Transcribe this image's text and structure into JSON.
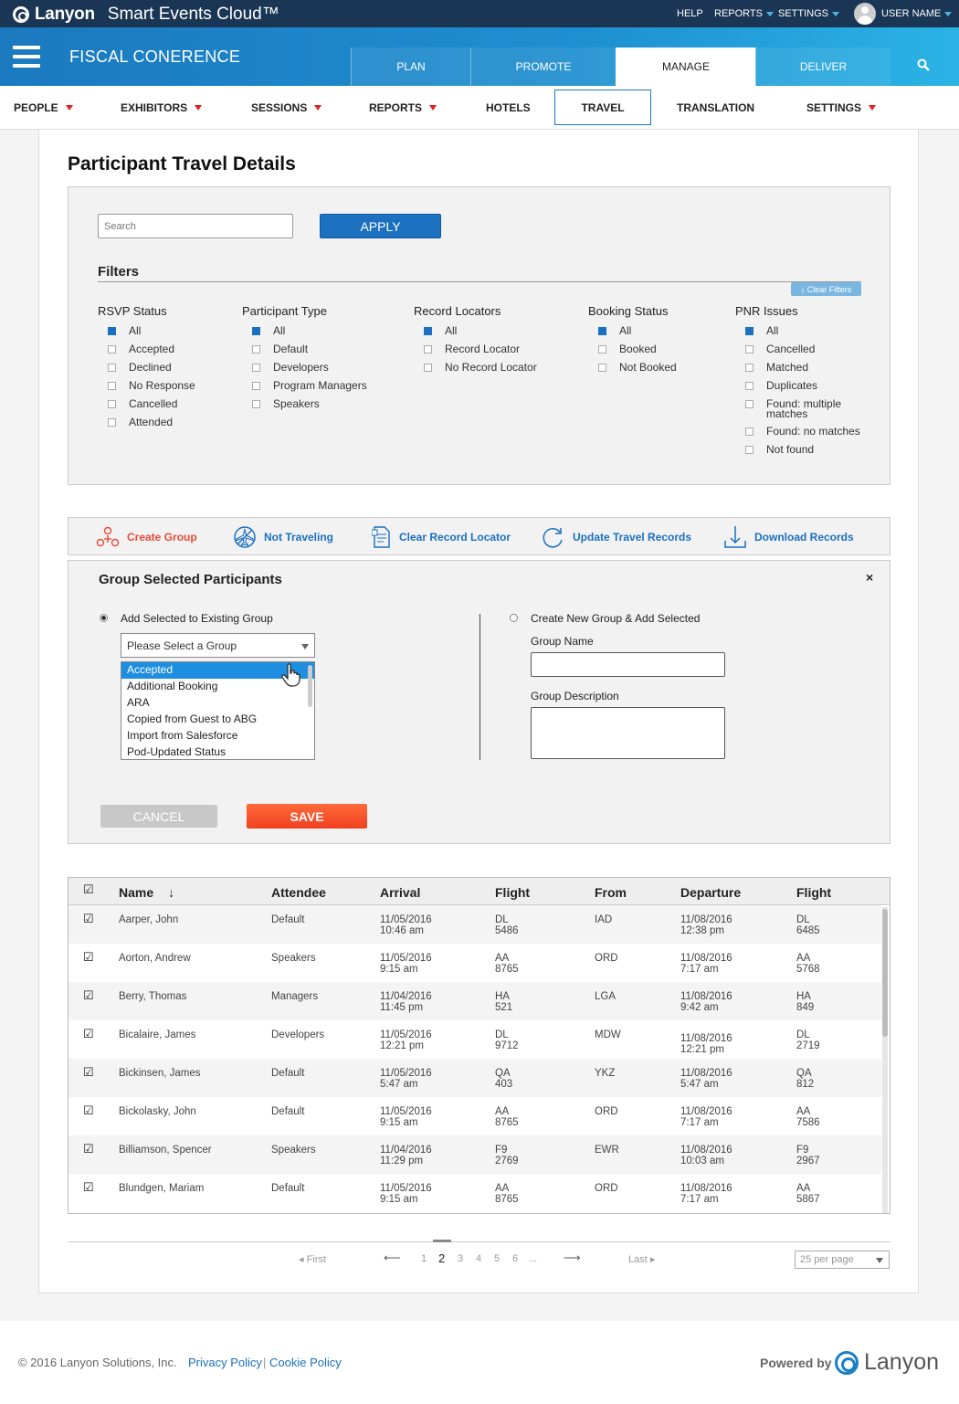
{
  "app": {
    "brand": "Lanyon",
    "product": "Smart Events Cloud™",
    "top_links": [
      "HELP",
      "REPORTS",
      "SETTINGS"
    ],
    "user": "USER NAME"
  },
  "event": {
    "name": "FISCAL CONERENCE",
    "tabs": [
      "PLAN",
      "PROMOTE",
      "MANAGE",
      "DELIVER"
    ],
    "active_tab": "MANAGE"
  },
  "subnav": {
    "items": [
      "PEOPLE",
      "EXHIBITORS",
      "SESSIONS",
      "REPORTS",
      "HOTELS",
      "TRAVEL",
      "TRANSLATION",
      "SETTINGS"
    ],
    "active": "TRAVEL"
  },
  "page": {
    "title": "Participant Travel Details"
  },
  "search": {
    "placeholder": "Search",
    "apply": "APPLY"
  },
  "filters": {
    "title": "Filters",
    "clear": "↓ Clear Filters",
    "groups": [
      {
        "title": "RSVP Status",
        "items": [
          {
            "label": "All",
            "checked": true
          },
          {
            "label": "Accepted",
            "checked": false
          },
          {
            "label": "Declined",
            "checked": false
          },
          {
            "label": "No Response",
            "checked": false
          },
          {
            "label": "Cancelled",
            "checked": false
          },
          {
            "label": "Attended",
            "checked": false
          }
        ]
      },
      {
        "title": "Participant Type",
        "items": [
          {
            "label": "All",
            "checked": true
          },
          {
            "label": "Default",
            "checked": false
          },
          {
            "label": "Developers",
            "checked": false
          },
          {
            "label": "Program Managers",
            "checked": false
          },
          {
            "label": "Speakers",
            "checked": false
          }
        ]
      },
      {
        "title": "Record Locators",
        "items": [
          {
            "label": "All",
            "checked": true
          },
          {
            "label": "Record Locator",
            "checked": false
          },
          {
            "label": "No Record Locator",
            "checked": false
          }
        ]
      },
      {
        "title": "Booking Status",
        "items": [
          {
            "label": "All",
            "checked": true
          },
          {
            "label": "Booked",
            "checked": false
          },
          {
            "label": "Not Booked",
            "checked": false
          }
        ]
      },
      {
        "title": "PNR Issues",
        "items": [
          {
            "label": "All",
            "checked": true
          },
          {
            "label": "Cancelled",
            "checked": false
          },
          {
            "label": "Matched",
            "checked": false
          },
          {
            "label": "Duplicates",
            "checked": false
          },
          {
            "label": "Found: multiple matches",
            "checked": false
          },
          {
            "label": "Found: no matches",
            "checked": false
          },
          {
            "label": "Not found",
            "checked": false
          }
        ]
      }
    ]
  },
  "actions": {
    "create_group": "Create Group",
    "not_traveling": "Not Traveling",
    "clear_locator": "Clear Record Locator",
    "update": "Update Travel Records",
    "download": "Download Records"
  },
  "group_panel": {
    "title": "Group Selected Participants",
    "close": "×",
    "existing_label": "Add Selected to Existing Group",
    "new_label": "Create New Group & Add Selected",
    "select_placeholder": "Please Select a Group",
    "options": [
      "Accepted",
      "Additional Booking",
      "ARA",
      "Copied from Guest to ABG",
      "Import from Salesforce",
      "Pod-Updated Status"
    ],
    "selected_option": "Accepted",
    "group_name_label": "Group Name",
    "group_desc_label": "Group Description",
    "cancel": "CANCEL",
    "save": "SAVE"
  },
  "table": {
    "headers": [
      "Name",
      "Attendee",
      "Arrival",
      "Flight",
      "From",
      "Departure",
      "Flight"
    ],
    "sort_icon": "↓",
    "rows": [
      {
        "name": "Aarper, John",
        "attendee": "Default",
        "arr_date": "11/05/2016",
        "arr_time": "10:46 am",
        "fl_air": "DL",
        "fl_num": "5486",
        "from": "IAD",
        "dep_date": "11/08/2016",
        "dep_time": "12:38 pm",
        "fl2_air": "DL",
        "fl2_num": "6485"
      },
      {
        "name": "Aorton, Andrew",
        "attendee": "Speakers",
        "arr_date": "11/05/2016",
        "arr_time": "9:15 am",
        "fl_air": "AA",
        "fl_num": "8765",
        "from": "ORD",
        "dep_date": "11/08/2016",
        "dep_time": "7:17 am",
        "fl2_air": "AA",
        "fl2_num": "5768"
      },
      {
        "name": "Berry, Thomas",
        "attendee": "Managers",
        "arr_date": "11/04/2016",
        "arr_time": "11:45 pm",
        "fl_air": "HA",
        "fl_num": "521",
        "from": "LGA",
        "dep_date": "11/08/2016",
        "dep_time": "9:42 am",
        "fl2_air": "HA",
        "fl2_num": "849"
      },
      {
        "name": "Bicalaire, James",
        "attendee": "Developers",
        "arr_date": "11/05/2016",
        "arr_time": "12:21 pm",
        "fl_air": "DL",
        "fl_num": "9712",
        "from": "MDW",
        "dep_date": "11/08/2016",
        "dep_time": "12:21 pm",
        "fl2_air": "DL",
        "fl2_num": "2719"
      },
      {
        "name": "Bickinsen, James",
        "attendee": "Default",
        "arr_date": "11/05/2016",
        "arr_time": "5:47 am",
        "fl_air": "QA",
        "fl_num": "403",
        "from": "YKZ",
        "dep_date": "11/08/2016",
        "dep_time": "5:47 am",
        "fl2_air": "QA",
        "fl2_num": "812"
      },
      {
        "name": "Bickolasky, John",
        "attendee": "Default",
        "arr_date": "11/05/2016",
        "arr_time": "9:15 am",
        "fl_air": "AA",
        "fl_num": "8765",
        "from": "ORD",
        "dep_date": "11/08/2016",
        "dep_time": "7:17 am",
        "fl2_air": "AA",
        "fl2_num": "7586"
      },
      {
        "name": "Billiamson, Spencer",
        "attendee": "Speakers",
        "arr_date": "11/04/2016",
        "arr_time": "11:29 pm",
        "fl_air": "F9",
        "fl_num": "2769",
        "from": "EWR",
        "dep_date": "11/08/2016",
        "dep_time": "10:03 am",
        "fl2_air": "F9",
        "fl2_num": "2967"
      },
      {
        "name": "Blundgen, Mariam",
        "attendee": "Default",
        "arr_date": "11/05/2016",
        "arr_time": "9:15 am",
        "fl_air": "AA",
        "fl_num": "8765",
        "from": "ORD",
        "dep_date": "11/08/2016",
        "dep_time": "7:17 am",
        "fl2_air": "AA",
        "fl2_num": "5867"
      }
    ]
  },
  "pagination": {
    "first": "◂ First",
    "prev": "⟵",
    "pages": [
      "1",
      "2",
      "3",
      "4",
      "5",
      "6",
      "..."
    ],
    "current": "2",
    "next": "⟶",
    "last": "Last ▸",
    "per_page": "25 per page"
  },
  "footer": {
    "copyright": "© 2016 Lanyon Solutions, Inc.",
    "privacy": "Privacy Policy",
    "sep": "|",
    "cookie": "Cookie Policy",
    "powered": "Powered by",
    "logo": "Lanyon"
  }
}
